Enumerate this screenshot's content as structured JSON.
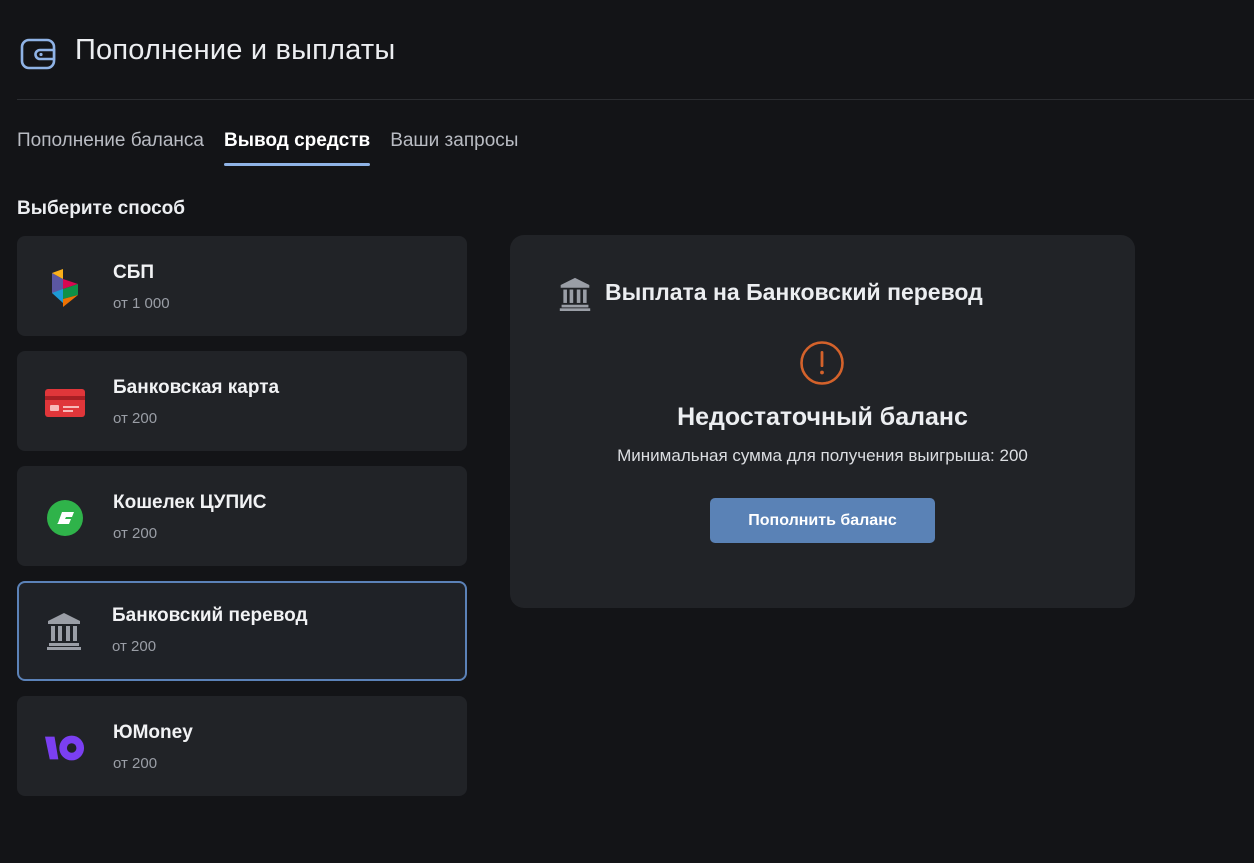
{
  "page": {
    "title": "Пополнение и выплаты",
    "icon": "wallet-icon"
  },
  "tabs": [
    {
      "label": "Пополнение баланса",
      "active": false
    },
    {
      "label": "Вывод средств",
      "active": true
    },
    {
      "label": "Ваши запросы",
      "active": false
    }
  ],
  "methods_title": "Выберите способ",
  "methods": [
    {
      "name": "СБП",
      "min": "от 1 000",
      "icon": "sbp-icon"
    },
    {
      "name": "Банковская карта",
      "min": "от 200",
      "icon": "bank-card-icon"
    },
    {
      "name": "Кошелек ЦУПИС",
      "min": "от 200",
      "icon": "cupis-wallet-icon"
    },
    {
      "name": "Банковский перевод",
      "min": "от 200",
      "icon": "bank-building-icon",
      "selected": true
    },
    {
      "name": "ЮMoney",
      "min": "от 200",
      "icon": "yoomoney-icon"
    }
  ],
  "panel": {
    "title": "Выплата на Банковский перевод",
    "title_icon": "bank-building-icon",
    "warning_icon": "exclamation-circle-icon",
    "warning_title": "Недостаточный баланс",
    "warning_text": "Минимальная сумма для получения выигрыша: 200",
    "button_label": "Пополнить баланс"
  },
  "colors": {
    "background": "#131417",
    "card": "#212327",
    "accent": "#5a82b6",
    "tab_underline": "#8fb3e6",
    "warning": "#d4622b",
    "card_icon": "#e0363a",
    "cupis": "#2fb34a",
    "yoomoney": "#7b3ff2"
  }
}
